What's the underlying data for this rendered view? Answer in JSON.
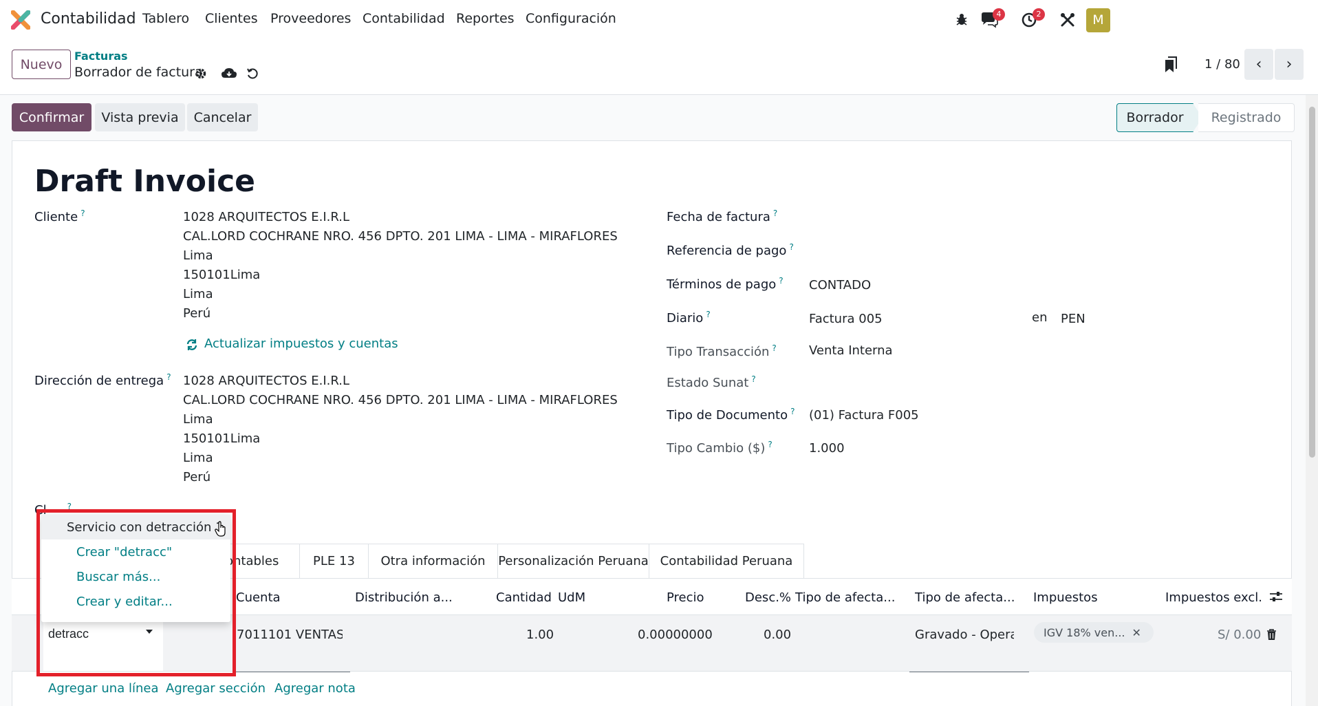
{
  "navbar": {
    "app_name": "Contabilidad",
    "menu": [
      "Tablero",
      "Clientes",
      "Proveedores",
      "Contabilidad",
      "Reportes",
      "Configuración"
    ],
    "chat_badge": "4",
    "activity_badge": "2",
    "avatar_letter": "M"
  },
  "control": {
    "new_label": "Nuevo",
    "breadcrumb": "Facturas",
    "record_name": "Borrador de factura",
    "pager": "1 / 80"
  },
  "actions": {
    "confirm": "Confirmar",
    "preview": "Vista previa",
    "cancel": "Cancelar",
    "status": [
      "Borrador",
      "Registrado"
    ]
  },
  "form": {
    "title": "Draft Invoice",
    "customer_label": "Cliente",
    "customer_address": [
      "1028 ARQUITECTOS E.I.R.L",
      "CAL.LORD COCHRANE NRO. 456 DPTO. 201 LIMA - LIMA - MIRAFLORES",
      "Lima",
      "150101Lima",
      "Lima",
      "Perú"
    ],
    "update_link": "Actualizar impuestos y cuentas",
    "delivery_label": "Dirección de entrega",
    "delivery_address": [
      "1028 ARQUITECTOS E.I.R.L",
      "CAL.LORD COCHRANE NRO. 456 DPTO. 201 LIMA - LIMA - MIRAFLORES",
      "Lima",
      "150101Lima",
      "Lima",
      "Perú"
    ],
    "partial_label": "Cl",
    "invoice_date_label": "Fecha de factura",
    "payment_ref_label": "Referencia de pago",
    "payment_terms_label": "Términos de pago",
    "payment_terms_value": "CONTADO",
    "journal_label": "Diario",
    "journal_value": "Factura 005",
    "journal_in": "en",
    "currency": "PEN",
    "transaction_label": "Tipo Transacción",
    "transaction_value": "Venta Interna",
    "sunat_label": "Estado Sunat",
    "doc_type_label": "Tipo de Documento",
    "doc_type_value": "(01) Factura F005",
    "exchange_label": "Tipo Cambio ($)",
    "exchange_value": "1.000"
  },
  "tabs": [
    "ontables",
    "PLE 13",
    "Otra información",
    "Personalización Peruana",
    "Contabilidad Peruana"
  ],
  "table": {
    "headers": [
      "Cuenta",
      "Distribución a...",
      "Cantidad",
      "UdM",
      "Precio",
      "Desc.%",
      "Tipo de afecta...",
      "Tipo de afecta...",
      "Impuestos",
      "Impuestos excl."
    ],
    "row": {
      "product_input": "detracc",
      "account": "7011101 VENTAS",
      "quantity": "1.00",
      "price": "0.00000000",
      "discount": "0.00",
      "affect_type": "Gravado - Opera",
      "tax_tag": "IGV 18% ven...",
      "subtotal": "S/ 0.00"
    }
  },
  "bottom_links": [
    "Agregar una línea",
    "Agregar sección",
    "Agregar nota"
  ],
  "dropdown": {
    "items": [
      "Servicio con detracción 1",
      "Crear \"detracc\"",
      "Buscar más...",
      "Crear y editar..."
    ]
  },
  "colors": {
    "primary": "#714b67",
    "link": "#017e84",
    "highlight": "#e3202a"
  }
}
